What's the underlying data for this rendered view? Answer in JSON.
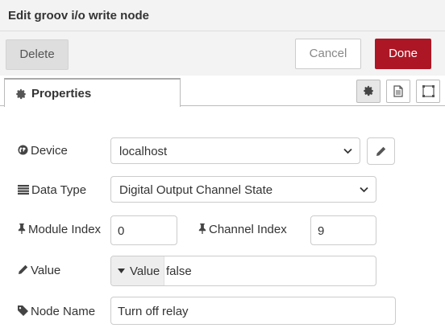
{
  "dialog": {
    "title": "Edit groov i/o write node"
  },
  "actions": {
    "delete_label": "Delete",
    "cancel_label": "Cancel",
    "done_label": "Done"
  },
  "tabs": {
    "properties_label": "Properties"
  },
  "form": {
    "device": {
      "label": "Device",
      "value": "localhost"
    },
    "data_type": {
      "label": "Data Type",
      "value": "Digital Output Channel State"
    },
    "module_index": {
      "label": "Module Index",
      "value": "0"
    },
    "channel_index": {
      "label": "Channel Index",
      "value": "9"
    },
    "value": {
      "label": "Value",
      "type": "Value",
      "value": "false"
    },
    "node_name": {
      "label": "Node Name",
      "value": "Turn off relay"
    }
  },
  "colors": {
    "done_button": "#ad1625",
    "header_bg": "#f3f3f3",
    "delete_button": "#dedede"
  },
  "icons": {
    "tab": "gear-icon",
    "device": "globe-icon",
    "data_type": "list-icon",
    "module_index": "pushpin-icon",
    "channel_index": "pushpin-icon",
    "value": "pencil-icon",
    "node_name": "tag-icon"
  }
}
